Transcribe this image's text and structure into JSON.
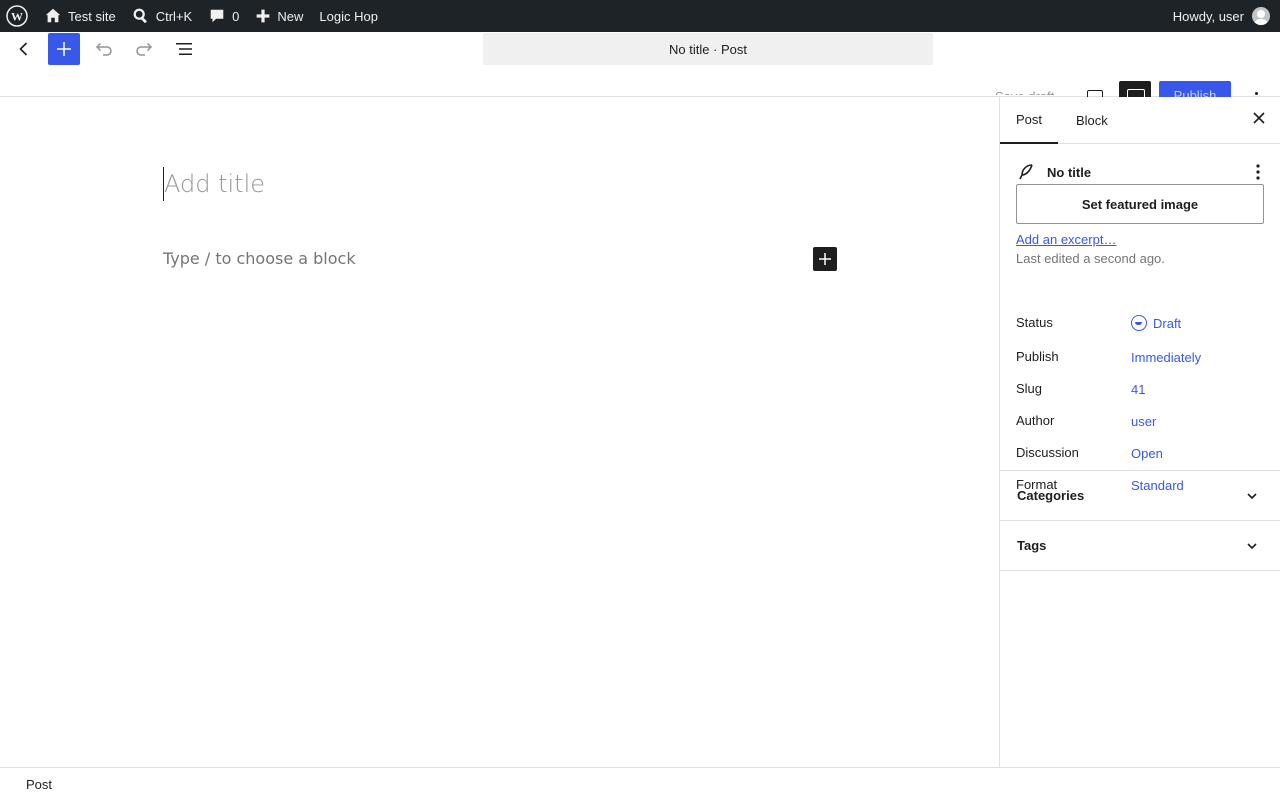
{
  "adminbar": {
    "site_name": "Test site",
    "search_shortcut": "Ctrl+K",
    "comments_count": "0",
    "new_label": "New",
    "plugin_label": "Logic Hop",
    "greeting": "Howdy, user"
  },
  "header": {
    "document_title": "No title · Post",
    "save_draft": "Save draft",
    "publish": "Publish"
  },
  "editor": {
    "title_placeholder": "Add title",
    "block_placeholder": "Type / to choose a block"
  },
  "sidebar": {
    "tabs": [
      "Post",
      "Block"
    ],
    "post_title": "No title",
    "featured_image": "Set featured image",
    "excerpt_link": "Add an excerpt…",
    "last_edited": "Last edited a second ago.",
    "fields": [
      {
        "label": "Status",
        "value": "Draft"
      },
      {
        "label": "Publish",
        "value": "Immediately"
      },
      {
        "label": "Slug",
        "value": "41"
      },
      {
        "label": "Author",
        "value": "user"
      },
      {
        "label": "Discussion",
        "value": "Open"
      },
      {
        "label": "Format",
        "value": "Standard"
      }
    ],
    "panels": [
      "Categories",
      "Tags"
    ]
  },
  "footer": {
    "breadcrumb": "Post"
  },
  "colors": {
    "accent": "#3858e9",
    "adminbar": "#1d2327"
  }
}
